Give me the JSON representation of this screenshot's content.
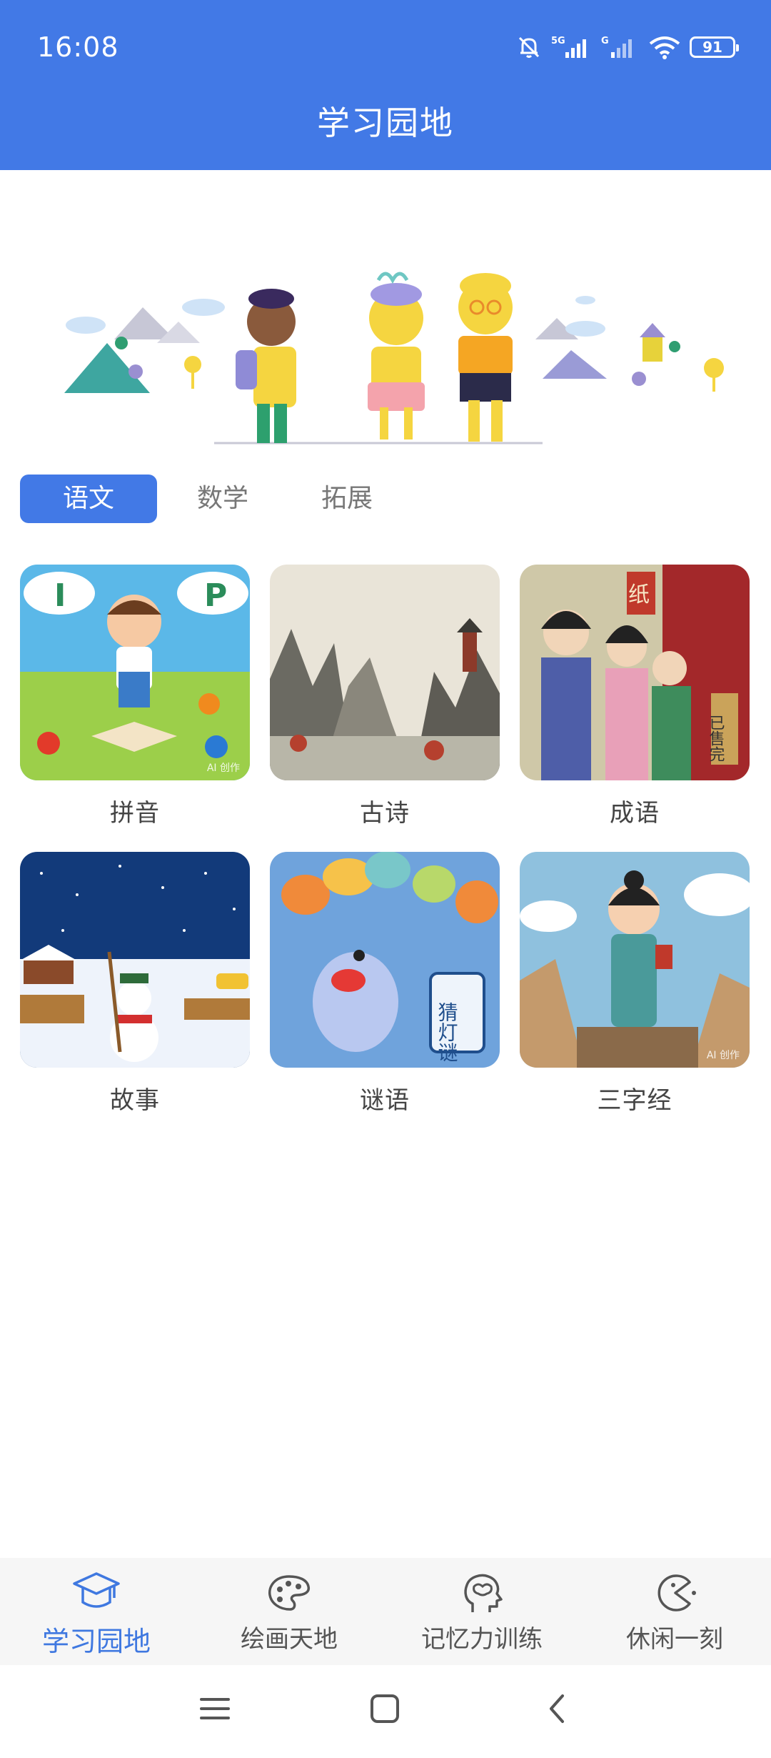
{
  "status_bar": {
    "time": "16:08",
    "network_5g": "5G",
    "network_g": "G",
    "battery": "91"
  },
  "header": {
    "title": "学习园地"
  },
  "tabs": [
    {
      "label": "语文",
      "active": true
    },
    {
      "label": "数学",
      "active": false
    },
    {
      "label": "拓展",
      "active": false
    }
  ],
  "cards": [
    {
      "label": "拼音",
      "image": "pinyin-cartoon-boy-with-book",
      "letters": [
        "I",
        "P"
      ],
      "watermark": "AI 创作"
    },
    {
      "label": "古诗",
      "image": "ink-landscape-mountains-pagoda"
    },
    {
      "label": "成语",
      "image": "ancient-chinese-people-street",
      "signs": [
        "纸",
        "已售完"
      ]
    },
    {
      "label": "故事",
      "image": "snowman-winter-night"
    },
    {
      "label": "谜语",
      "image": "lantern-riddle-monster",
      "sign_text": "猜灯谜"
    },
    {
      "label": "三字经",
      "image": "child-reading-scroll",
      "watermark": "AI 创作"
    }
  ],
  "bottom_nav": [
    {
      "label": "学习园地",
      "icon": "graduation-cap-icon",
      "active": true
    },
    {
      "label": "绘画天地",
      "icon": "palette-icon",
      "active": false
    },
    {
      "label": "记忆力训练",
      "icon": "brain-head-icon",
      "active": false
    },
    {
      "label": "休闲一刻",
      "icon": "pacman-icon",
      "active": false
    }
  ],
  "system_nav": [
    "menu-icon",
    "home-square-icon",
    "back-chevron-icon"
  ],
  "colors": {
    "accent": "#4279e6",
    "nav_active": "#3f78e0",
    "nav_inactive": "#555555"
  }
}
